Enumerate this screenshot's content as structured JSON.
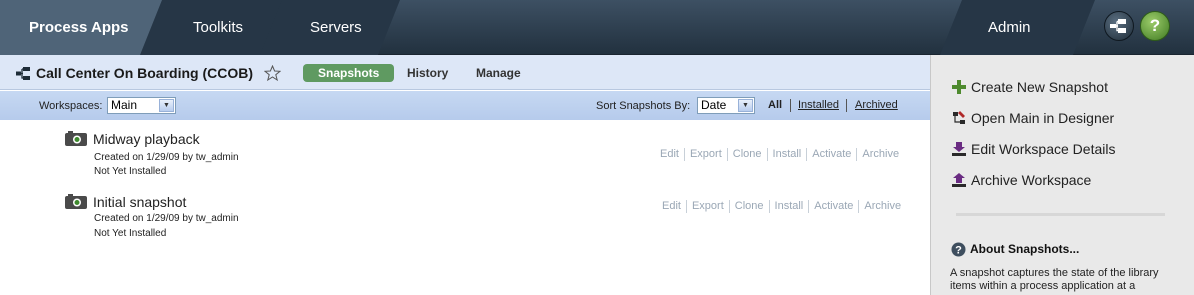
{
  "nav": {
    "tabs": [
      {
        "label": "Process Apps"
      },
      {
        "label": "Toolkits"
      },
      {
        "label": "Servers"
      }
    ],
    "user_label": "Admin",
    "help_glyph": "?"
  },
  "app": {
    "title": "Call Center On Boarding (CCOB)",
    "subtabs": [
      {
        "label": "Snapshots"
      },
      {
        "label": "History"
      },
      {
        "label": "Manage"
      }
    ]
  },
  "toolbar": {
    "workspaces_label": "Workspaces:",
    "workspace_value": "Main",
    "sort_label": "Sort Snapshots By:",
    "sort_value": "Date",
    "filters": [
      {
        "label": "All"
      },
      {
        "label": "Installed"
      },
      {
        "label": "Archived"
      }
    ]
  },
  "snapshots": [
    {
      "name": "Midway playback",
      "created": "Created on 1/29/09 by tw_admin",
      "status": "Not Yet Installed"
    },
    {
      "name": "Initial snapshot",
      "created": "Created on 1/29/09 by tw_admin",
      "status": "Not Yet Installed"
    }
  ],
  "snapshot_actions": [
    "Edit",
    "Export",
    "Clone",
    "Install",
    "Activate",
    "Archive"
  ],
  "sidebar": {
    "links": [
      {
        "label": "Create New Snapshot",
        "icon": "plus-icon"
      },
      {
        "label": "Open Main in Designer",
        "icon": "designer-icon"
      },
      {
        "label": "Edit Workspace Details",
        "icon": "download-icon"
      },
      {
        "label": "Archive Workspace",
        "icon": "upload-icon"
      }
    ],
    "about_title": "About Snapshots...",
    "about_text": "A snapshot captures the state of the library items within a process application at a"
  },
  "colors": {
    "nav_bg": "#2c3e50",
    "active_subtab": "#5f9a61",
    "header_bg": "#dde7f7",
    "toolbar_bg": "#bcd0ee",
    "sidebar_bg": "#e9e9e9",
    "action_link": "#9aa7b5"
  }
}
